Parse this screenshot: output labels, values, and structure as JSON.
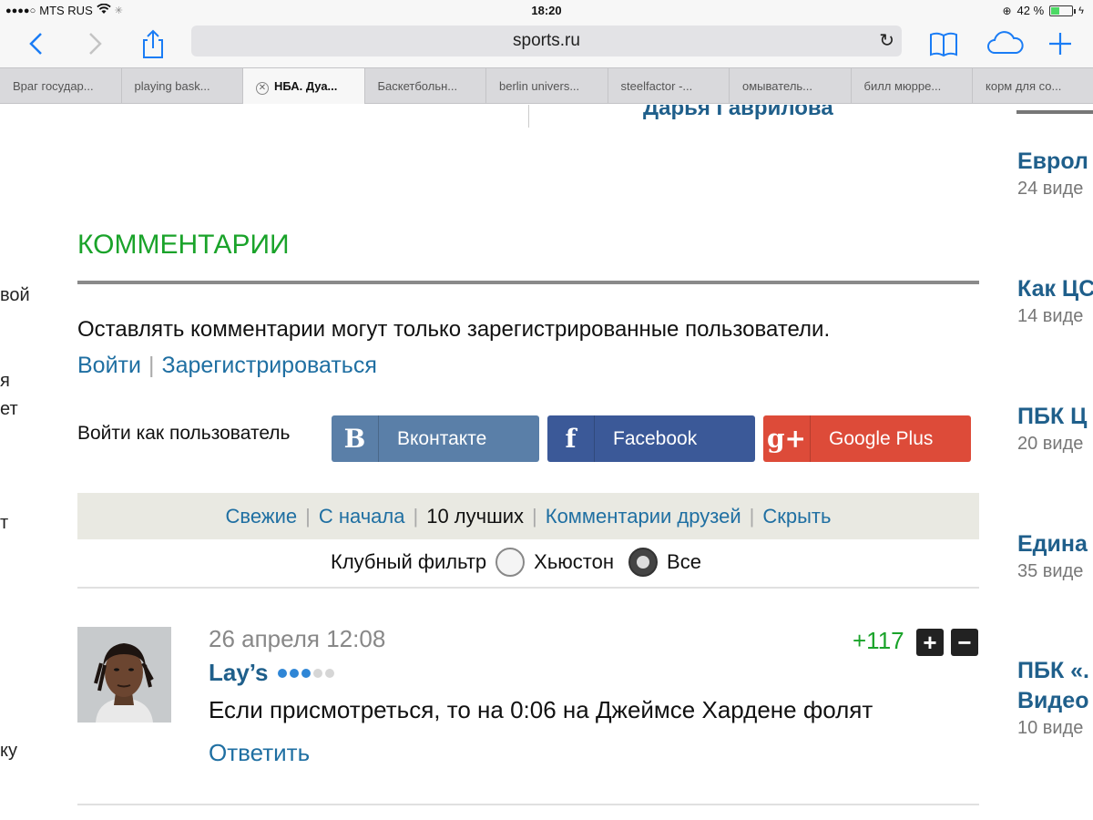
{
  "status": {
    "carrier": "MTS RUS",
    "time": "18:20",
    "battery": "42 %",
    "battery_level": 0.42
  },
  "browser": {
    "url": "sports.ru",
    "tabs": [
      {
        "label": "Враг государ..."
      },
      {
        "label": "playing bask..."
      },
      {
        "label": "НБА. Дуа..."
      },
      {
        "label": "Баскетбольн..."
      },
      {
        "label": "berlin univers..."
      },
      {
        "label": "steelfactor -..."
      },
      {
        "label": "омыватель..."
      },
      {
        "label": "билл мюрре..."
      },
      {
        "label": "корм для со..."
      }
    ]
  },
  "page": {
    "author_fragment": "Дарья Гаврилова",
    "left_fragments": [
      "вой",
      "я",
      "ет",
      "т",
      "ку"
    ],
    "right_items": [
      {
        "title": "Еврол",
        "sub": "24 виде"
      },
      {
        "title": "Как ЦС",
        "sub": "14 виде"
      },
      {
        "title": "ПБК Ц",
        "sub": "20 виде"
      },
      {
        "title": "Едина",
        "sub": "35 виде"
      },
      {
        "title": "ПБК «.",
        "title2": "Видео",
        "sub": "10 виде"
      }
    ]
  },
  "comments": {
    "heading": "КОММЕНТАРИИ",
    "notice": "Оставлять комментарии могут только зарегистрированные пользователи.",
    "login_link": "Войти",
    "register_link": "Зарегистрироваться",
    "social_label": "Войти как пользователь",
    "social": [
      {
        "label": "Вконтакте",
        "icon": "В",
        "color": "#5a7fa8"
      },
      {
        "label": "Facebook",
        "icon": "f",
        "color": "#3b5998"
      },
      {
        "label": "Google Plus",
        "icon": "g+",
        "color": "#dd4b39"
      }
    ],
    "sort": {
      "fresh": "Свежие",
      "from_start": "С начала",
      "best": "10 лучших",
      "friends": "Комментарии друзей",
      "hide": "Скрыть"
    },
    "club_filter": {
      "label": "Клубный фильтр",
      "option1": "Хьюстон",
      "option2": "Все",
      "selected": "Все"
    },
    "items": [
      {
        "date": "26 апреля 12:08",
        "user": "Lay’s",
        "rating_dots": 3,
        "rating_dots_total": 5,
        "text": "Если присмотреться, то на 0:06 на Джеймсе Хардене фолят",
        "reply": "Ответить",
        "score": "+117"
      }
    ]
  },
  "colors": {
    "link": "#1f6fa2",
    "heading_green": "#1aa32a",
    "ios_blue": "#1a7cf5"
  }
}
